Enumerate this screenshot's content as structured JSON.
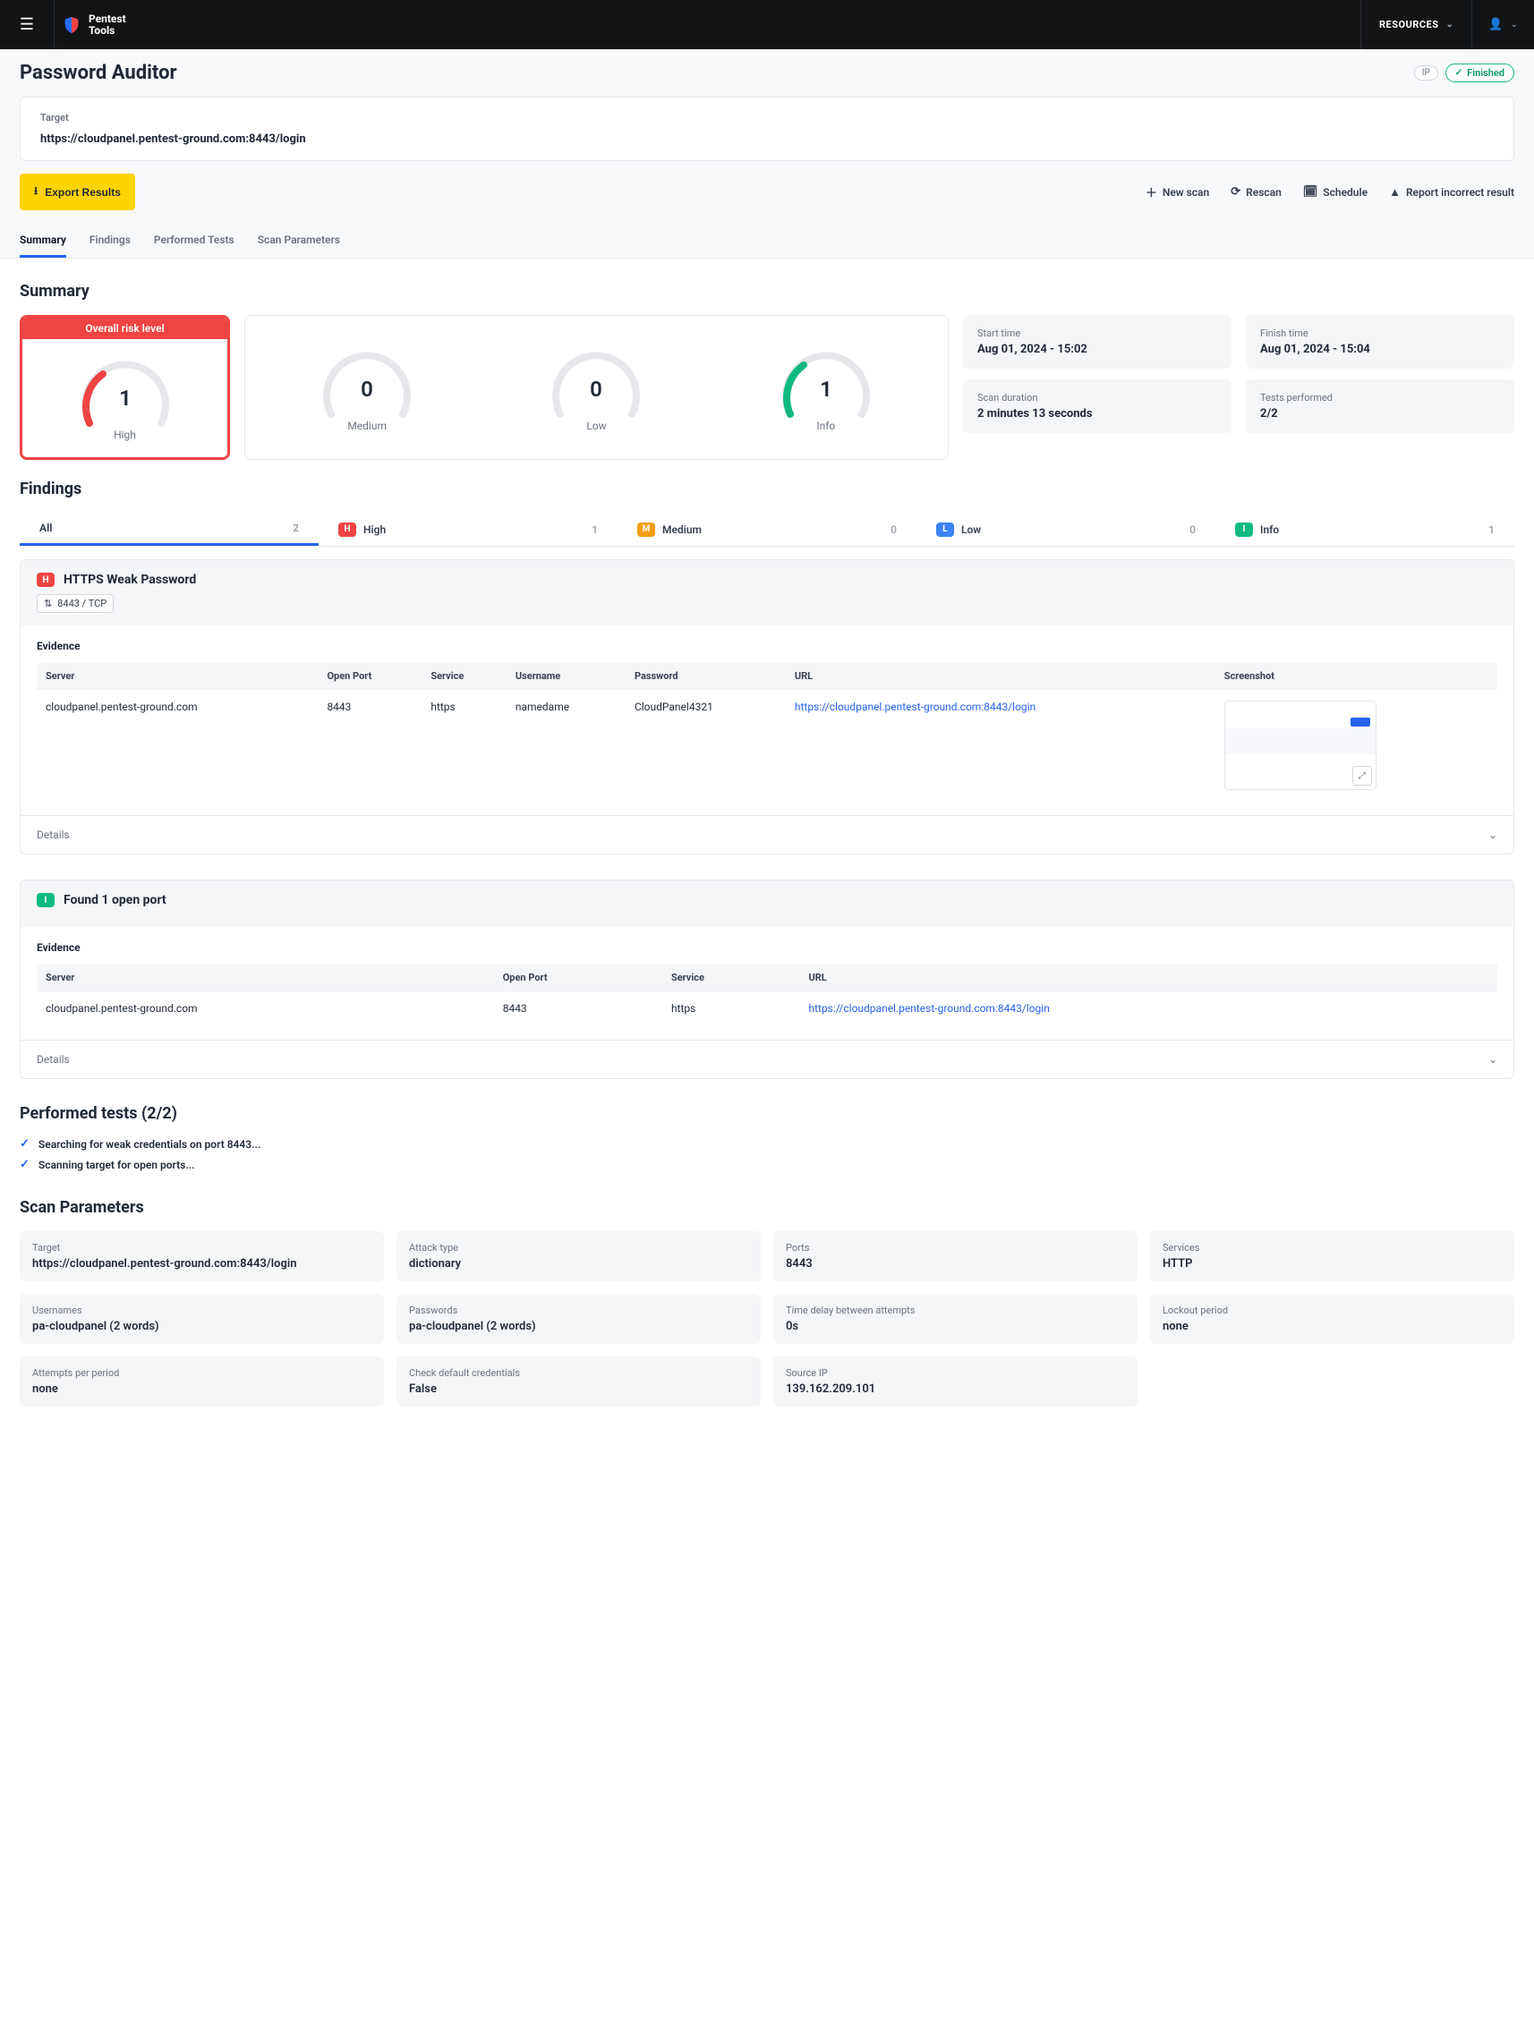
{
  "brand": {
    "line1": "Pentest",
    "line2": "Tools"
  },
  "topbar": {
    "resources": "RESOURCES"
  },
  "page": {
    "title": "Password Auditor",
    "ip_badge": "IP",
    "status": "Finished"
  },
  "target": {
    "label": "Target",
    "value": "https://cloudpanel.pentest-ground.com:8443/login"
  },
  "toolbar": {
    "export": "Export Results",
    "new_scan": "New scan",
    "rescan": "Rescan",
    "schedule": "Schedule",
    "report": "Report incorrect result"
  },
  "tabs": [
    "Summary",
    "Findings",
    "Performed Tests",
    "Scan Parameters"
  ],
  "summary": {
    "title": "Summary",
    "risk_banner": "Overall risk level",
    "gauges": {
      "high": {
        "value": "1",
        "label": "High"
      },
      "medium": {
        "value": "0",
        "label": "Medium"
      },
      "low": {
        "value": "0",
        "label": "Low"
      },
      "info": {
        "value": "1",
        "label": "Info"
      }
    },
    "meta": {
      "start_label": "Start time",
      "start_value": "Aug 01, 2024 - 15:02",
      "finish_label": "Finish time",
      "finish_value": "Aug 01, 2024 - 15:04",
      "duration_label": "Scan duration",
      "duration_value": "2 minutes 13 seconds",
      "tests_label": "Tests performed",
      "tests_value": "2/2"
    }
  },
  "findings_section": {
    "title": "Findings"
  },
  "filter": {
    "all": "All",
    "all_count": "2",
    "high": "High",
    "high_count": "1",
    "medium": "Medium",
    "medium_count": "0",
    "low": "Low",
    "low_count": "0",
    "info": "Info",
    "info_count": "1"
  },
  "finding1": {
    "severity": "H",
    "title": "HTTPS Weak Password",
    "port_chip": "8443 / TCP",
    "evidence_label": "Evidence",
    "headers": {
      "server": "Server",
      "port": "Open Port",
      "service": "Service",
      "user": "Username",
      "pass": "Password",
      "url": "URL",
      "screenshot": "Screenshot"
    },
    "row": {
      "server": "cloudpanel.pentest-ground.com",
      "port": "8443",
      "service": "https",
      "user": "namedame",
      "pass": "CloudPanel4321",
      "url": "https://cloudpanel.pentest-ground.com:8443/login"
    },
    "details": "Details"
  },
  "finding2": {
    "severity": "I",
    "title": "Found 1 open port",
    "evidence_label": "Evidence",
    "headers": {
      "server": "Server",
      "port": "Open Port",
      "service": "Service",
      "url": "URL"
    },
    "row": {
      "server": "cloudpanel.pentest-ground.com",
      "port": "8443",
      "service": "https",
      "url": "https://cloudpanel.pentest-ground.com:8443/login"
    },
    "details": "Details"
  },
  "performed": {
    "title": "Performed tests (2/2)",
    "items": [
      "Searching for weak credentials on port 8443...",
      "Scanning target for open ports..."
    ]
  },
  "params": {
    "title": "Scan Parameters",
    "boxes": [
      {
        "label": "Target",
        "value": "https://cloudpanel.pentest-ground.com:8443/login"
      },
      {
        "label": "Attack type",
        "value": "dictionary"
      },
      {
        "label": "Ports",
        "value": "8443"
      },
      {
        "label": "Services",
        "value": "HTTP"
      },
      {
        "label": "Usernames",
        "value": "pa-cloudpanel (2 words)"
      },
      {
        "label": "Passwords",
        "value": "pa-cloudpanel (2 words)"
      },
      {
        "label": "Time delay between attempts",
        "value": "0s"
      },
      {
        "label": "Lockout period",
        "value": "none"
      },
      {
        "label": "Attempts per period",
        "value": "none"
      },
      {
        "label": "Check default credentials",
        "value": "False"
      },
      {
        "label": "Source IP",
        "value": "139.162.209.101"
      }
    ]
  }
}
